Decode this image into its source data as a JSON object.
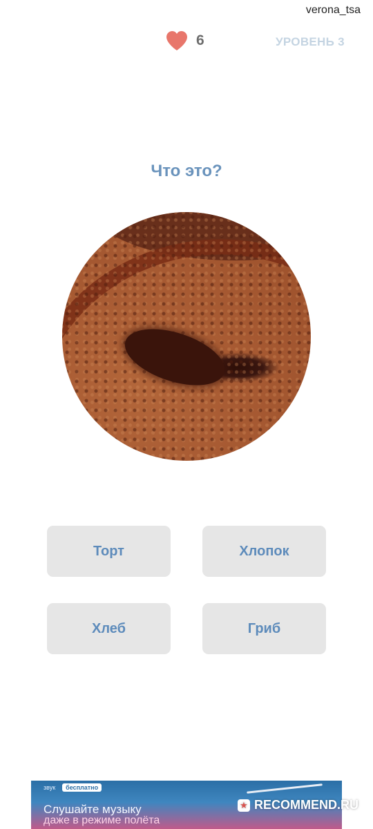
{
  "header": {
    "username": "verona_tsa",
    "lives_count": "6",
    "level_label": "УРОВЕНЬ 3",
    "heart_color": "#e8766b"
  },
  "quiz": {
    "question": "Что это?",
    "answers": [
      "Торт",
      "Хлопок",
      "Хлеб",
      "Гриб"
    ]
  },
  "ad": {
    "brand": "звук",
    "badge": "бесплатно",
    "line1": "Слушайте музыку",
    "line2": "даже в режиме полёта"
  },
  "watermark": {
    "text": "RECOMMEND.RU"
  },
  "colors": {
    "accent": "#6a93bc",
    "button_bg": "#e6e6e6",
    "level": "#c4d4e2"
  }
}
